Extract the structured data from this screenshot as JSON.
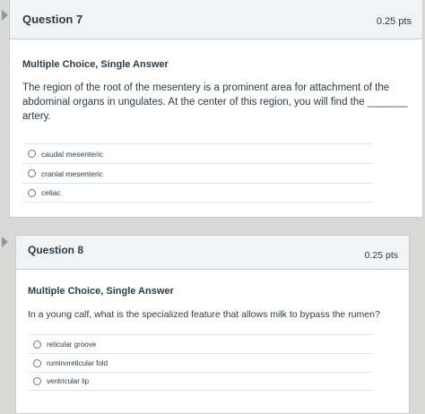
{
  "questions": [
    {
      "title": "Question 7",
      "points": "0.25 pts",
      "type": "Multiple Choice, Single Answer",
      "text_lines": [
        "The region of the root of the mesentery is a prominent area for attachment of the",
        "abdominal organs in ungulates. At the center of this region, you will find the _______",
        "artery."
      ],
      "answers": [
        "caudal mesenteric",
        "cranial mesenteric",
        "celiac"
      ]
    },
    {
      "title": "Question 8",
      "points": "0.25 pts",
      "type": "Multiple Choice, Single Answer",
      "text_lines": [
        "In a young calf, what is the specialized feature that allows milk to bypass the rumen?"
      ],
      "answers": [
        "reticular groove",
        "ruminoreticular fold",
        "ventricular lip"
      ]
    }
  ]
}
